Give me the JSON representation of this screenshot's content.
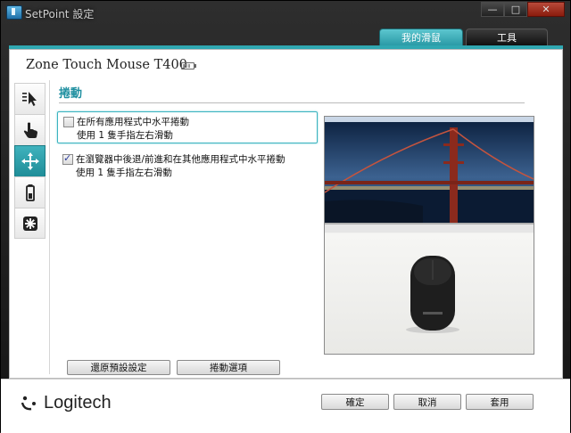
{
  "window": {
    "title": "SetPoint 設定",
    "minimize": "—",
    "maximize": "□",
    "close": "✕"
  },
  "tabs": [
    {
      "label": "我的滑鼠"
    },
    {
      "label": "工具"
    }
  ],
  "device": {
    "name": "Zone Touch Mouse T400"
  },
  "side_tabs": [
    {
      "icon": "pointer-speed-icon"
    },
    {
      "icon": "touch-hand-icon"
    },
    {
      "icon": "scroll-arrows-icon",
      "active": true
    },
    {
      "icon": "battery-icon"
    },
    {
      "icon": "settings-gear-icon"
    }
  ],
  "section": {
    "title": "捲動"
  },
  "options": [
    {
      "label": "在所有應用程式中水平捲動",
      "description": "使用 1 隻手指左右滑動",
      "checked": false
    },
    {
      "label": "在瀏覽器中後退/前進和在其他應用程式中水平捲動",
      "description": "使用 1 隻手指左右滑動",
      "checked": true
    }
  ],
  "content_buttons": {
    "restore": "還原預設設定",
    "scroll_options": "捲動選項"
  },
  "footer": {
    "brand": "Logitech",
    "ok": "確定",
    "cancel": "取消",
    "apply": "套用"
  },
  "colors": {
    "accent": "#2fa7b1",
    "accent_text": "#1e8fa0"
  }
}
